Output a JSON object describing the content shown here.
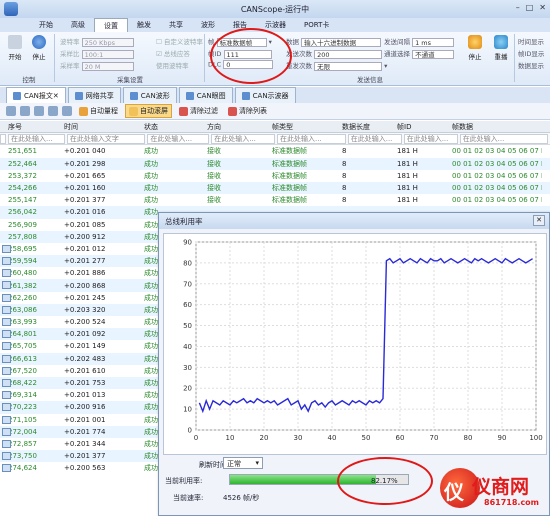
{
  "window": {
    "title": "CANScope-运行中"
  },
  "menu_tabs": [
    "开始",
    "高级",
    "设置",
    "触发",
    "共享",
    "波形",
    "报告",
    "示波器",
    "PORT卡"
  ],
  "active_menu_tab": 2,
  "ribbon": {
    "start_label": "开始",
    "stop_label": "停止",
    "group_control": "控制",
    "baud_label": "波特率",
    "baud_value": "250 Kbps",
    "ratio_label": "采样比",
    "ratio_value": "100:1",
    "sample_label": "采样率",
    "sample_value": "20 M",
    "auto_baud": "自定义波特率",
    "bus_resp": "总线应答",
    "use_baud": "使用波特率",
    "group_sample": "采集设置",
    "frame_type_label": "帧",
    "frame_type_value": "标准数据帧",
    "id_label": "帧ID",
    "id_value": "111",
    "dlc_label": "DLC",
    "dlc_value": "0",
    "data_label": "数据",
    "data_placeholder": "输入十六进制数据",
    "count_label": "发送次数",
    "count_value": "200",
    "interval_label": "发送间隔",
    "interval_value": "1 ms",
    "mode_label": "重发次数",
    "mode_value": "无限",
    "channel_label": "通道选择",
    "channel_value": "不通道",
    "send_stop": "停止",
    "send_repeat": "重播",
    "group_send": "发送信息",
    "right_items": [
      "时间显示",
      "帧ID显示",
      "数据显示"
    ]
  },
  "doc_tabs": [
    "CAN报文",
    "网络共享",
    "CAN波形",
    "CAN眼图",
    "CAN示波器"
  ],
  "toolbar": {
    "items": [
      "自动量程",
      "自动滚屏",
      "清除过滤",
      "清除列表"
    ],
    "active": 1
  },
  "table": {
    "headers": [
      "序号",
      "时间",
      "状态",
      "方向",
      "帧类型",
      "数据长度",
      "帧ID",
      "帧数据"
    ],
    "filters": [
      "在此处输入...",
      "在此处输入文字",
      "在此处输入...",
      "在此处输入...",
      "在此处输入...",
      "在此处输入...",
      "在此处输入...",
      "在此处输入..."
    ],
    "rows": [
      [
        "251,651",
        "+0.201 040",
        "成功",
        "接收",
        "标准数据帧",
        "8",
        "181 H",
        "00 01 02 03 04 05 06 07 H"
      ],
      [
        "252,464",
        "+0.201 298",
        "成功",
        "接收",
        "标准数据帧",
        "8",
        "181 H",
        "00 01 02 03 04 05 06 07 H"
      ],
      [
        "253,372",
        "+0.201 665",
        "成功",
        "接收",
        "标准数据帧",
        "8",
        "181 H",
        "00 01 02 03 04 05 06 07 H"
      ],
      [
        "254,266",
        "+0.201 160",
        "成功",
        "接收",
        "标准数据帧",
        "8",
        "181 H",
        "00 01 02 03 04 05 06 07 H"
      ],
      [
        "255,147",
        "+0.201 377",
        "成功",
        "接收",
        "标准数据帧",
        "8",
        "181 H",
        "00 01 02 03 04 05 06 07 H"
      ],
      [
        "256,042",
        "+0.201 016",
        "成功",
        "",
        "",
        "",
        "",
        ""
      ],
      [
        "256,909",
        "+0.201 085",
        "成功",
        "",
        "",
        "",
        "",
        ""
      ],
      [
        "257,808",
        "+0.200 912",
        "成功",
        "",
        "",
        "",
        "",
        ""
      ],
      [
        "258,695",
        "+0.201 012",
        "成功",
        "",
        "",
        "",
        "",
        ""
      ],
      [
        "259,594",
        "+0.201 277",
        "成功",
        "",
        "",
        "",
        "",
        ""
      ],
      [
        "260,480",
        "+0.201 886",
        "成功",
        "",
        "",
        "",
        "",
        ""
      ],
      [
        "261,382",
        "+0.200 868",
        "成功",
        "",
        "",
        "",
        "",
        ""
      ],
      [
        "262,260",
        "+0.201 245",
        "成功",
        "",
        "",
        "",
        "",
        ""
      ],
      [
        "263,086",
        "+0.203 320",
        "成功",
        "",
        "",
        "",
        "",
        ""
      ],
      [
        "263,993",
        "+0.200 524",
        "成功",
        "",
        "",
        "",
        "",
        ""
      ],
      [
        "264,801",
        "+0.201 092",
        "成功",
        "",
        "",
        "",
        "",
        ""
      ],
      [
        "265,705",
        "+0.201 149",
        "成功",
        "",
        "",
        "",
        "",
        ""
      ],
      [
        "266,613",
        "+0.202 483",
        "成功",
        "",
        "",
        "",
        "",
        ""
      ],
      [
        "267,520",
        "+0.201 610",
        "成功",
        "",
        "",
        "",
        "",
        ""
      ],
      [
        "268,422",
        "+0.201 753",
        "成功",
        "",
        "",
        "",
        "",
        ""
      ],
      [
        "269,314",
        "+0.201 013",
        "成功",
        "",
        "",
        "",
        "",
        ""
      ],
      [
        "270,223",
        "+0.200 916",
        "成功",
        "",
        "",
        "",
        "",
        ""
      ],
      [
        "271,105",
        "+0.201 001",
        "成功",
        "",
        "",
        "",
        "",
        ""
      ],
      [
        "272,004",
        "+0.201 774",
        "成功",
        "",
        "",
        "",
        "",
        ""
      ],
      [
        "272,857",
        "+0.201 344",
        "成功",
        "",
        "",
        "",
        "",
        ""
      ],
      [
        "273,750",
        "+0.201 377",
        "成功",
        "",
        "",
        "",
        "",
        ""
      ],
      [
        "274,624",
        "+0.200 563",
        "成功",
        "",
        "",
        "",
        "",
        ""
      ]
    ]
  },
  "dialog": {
    "title": "总线利用率",
    "refresh_label": "刷新时间:",
    "refresh_value": "正常",
    "util_label": "当前利用率:",
    "util_value": "82.17%",
    "util_fraction": 0.8217,
    "rate_label": "当前速率:",
    "rate_value": "4526 帧/秒"
  },
  "chart_data": {
    "type": "line",
    "xlim": [
      0,
      100
    ],
    "ylim": [
      0,
      90
    ],
    "xticks": [
      0,
      10,
      20,
      30,
      40,
      50,
      60,
      70,
      80,
      90,
      100
    ],
    "yticks": [
      0,
      10,
      20,
      30,
      40,
      50,
      60,
      70,
      80,
      90
    ],
    "grid": true,
    "series": [
      {
        "color": "#2a2ad8",
        "x": [
          1,
          2,
          3,
          4,
          5,
          6,
          7,
          8,
          9,
          10,
          11,
          12,
          13,
          14,
          15,
          16,
          17,
          18,
          19,
          20,
          21,
          22,
          23,
          24,
          25,
          26,
          27,
          28,
          29,
          30,
          31,
          32,
          33,
          34,
          35,
          36,
          37,
          38,
          39,
          40,
          41,
          42,
          43,
          44,
          45,
          46,
          47,
          48,
          49,
          50,
          51,
          52,
          53,
          54,
          55,
          56,
          57,
          58,
          59,
          60,
          61,
          62,
          63,
          64,
          65,
          66,
          67,
          68,
          69,
          70,
          71,
          72,
          73,
          74,
          75,
          76,
          77,
          78,
          79,
          80,
          81,
          82,
          83,
          84,
          85,
          86,
          87,
          88,
          89,
          90,
          91,
          92,
          93,
          94,
          95,
          96,
          97,
          98,
          99
        ],
        "y": [
          13,
          9,
          14,
          10,
          14,
          13,
          12,
          14,
          13,
          12,
          14,
          13,
          14,
          15,
          13,
          14,
          13,
          15,
          14,
          13,
          14,
          13,
          14,
          12,
          13,
          14,
          15,
          12,
          13,
          14,
          10,
          12,
          9,
          13,
          14,
          12,
          13,
          11,
          13,
          14,
          12,
          13,
          14,
          13,
          12,
          14,
          13,
          14,
          13,
          12,
          14,
          13,
          14,
          13,
          15,
          81,
          82,
          80,
          81,
          82,
          80,
          81,
          82,
          81,
          80,
          82,
          81,
          80,
          82,
          81,
          81,
          82,
          80,
          81,
          82,
          81,
          80,
          81,
          82,
          81,
          80,
          82,
          81,
          82,
          81,
          80,
          81,
          82,
          81,
          80,
          82,
          81,
          80,
          81,
          82,
          81,
          80,
          81,
          82
        ]
      }
    ]
  },
  "watermark": {
    "logo_char": "仪",
    "text": "仪商网",
    "url": "861718.com"
  }
}
